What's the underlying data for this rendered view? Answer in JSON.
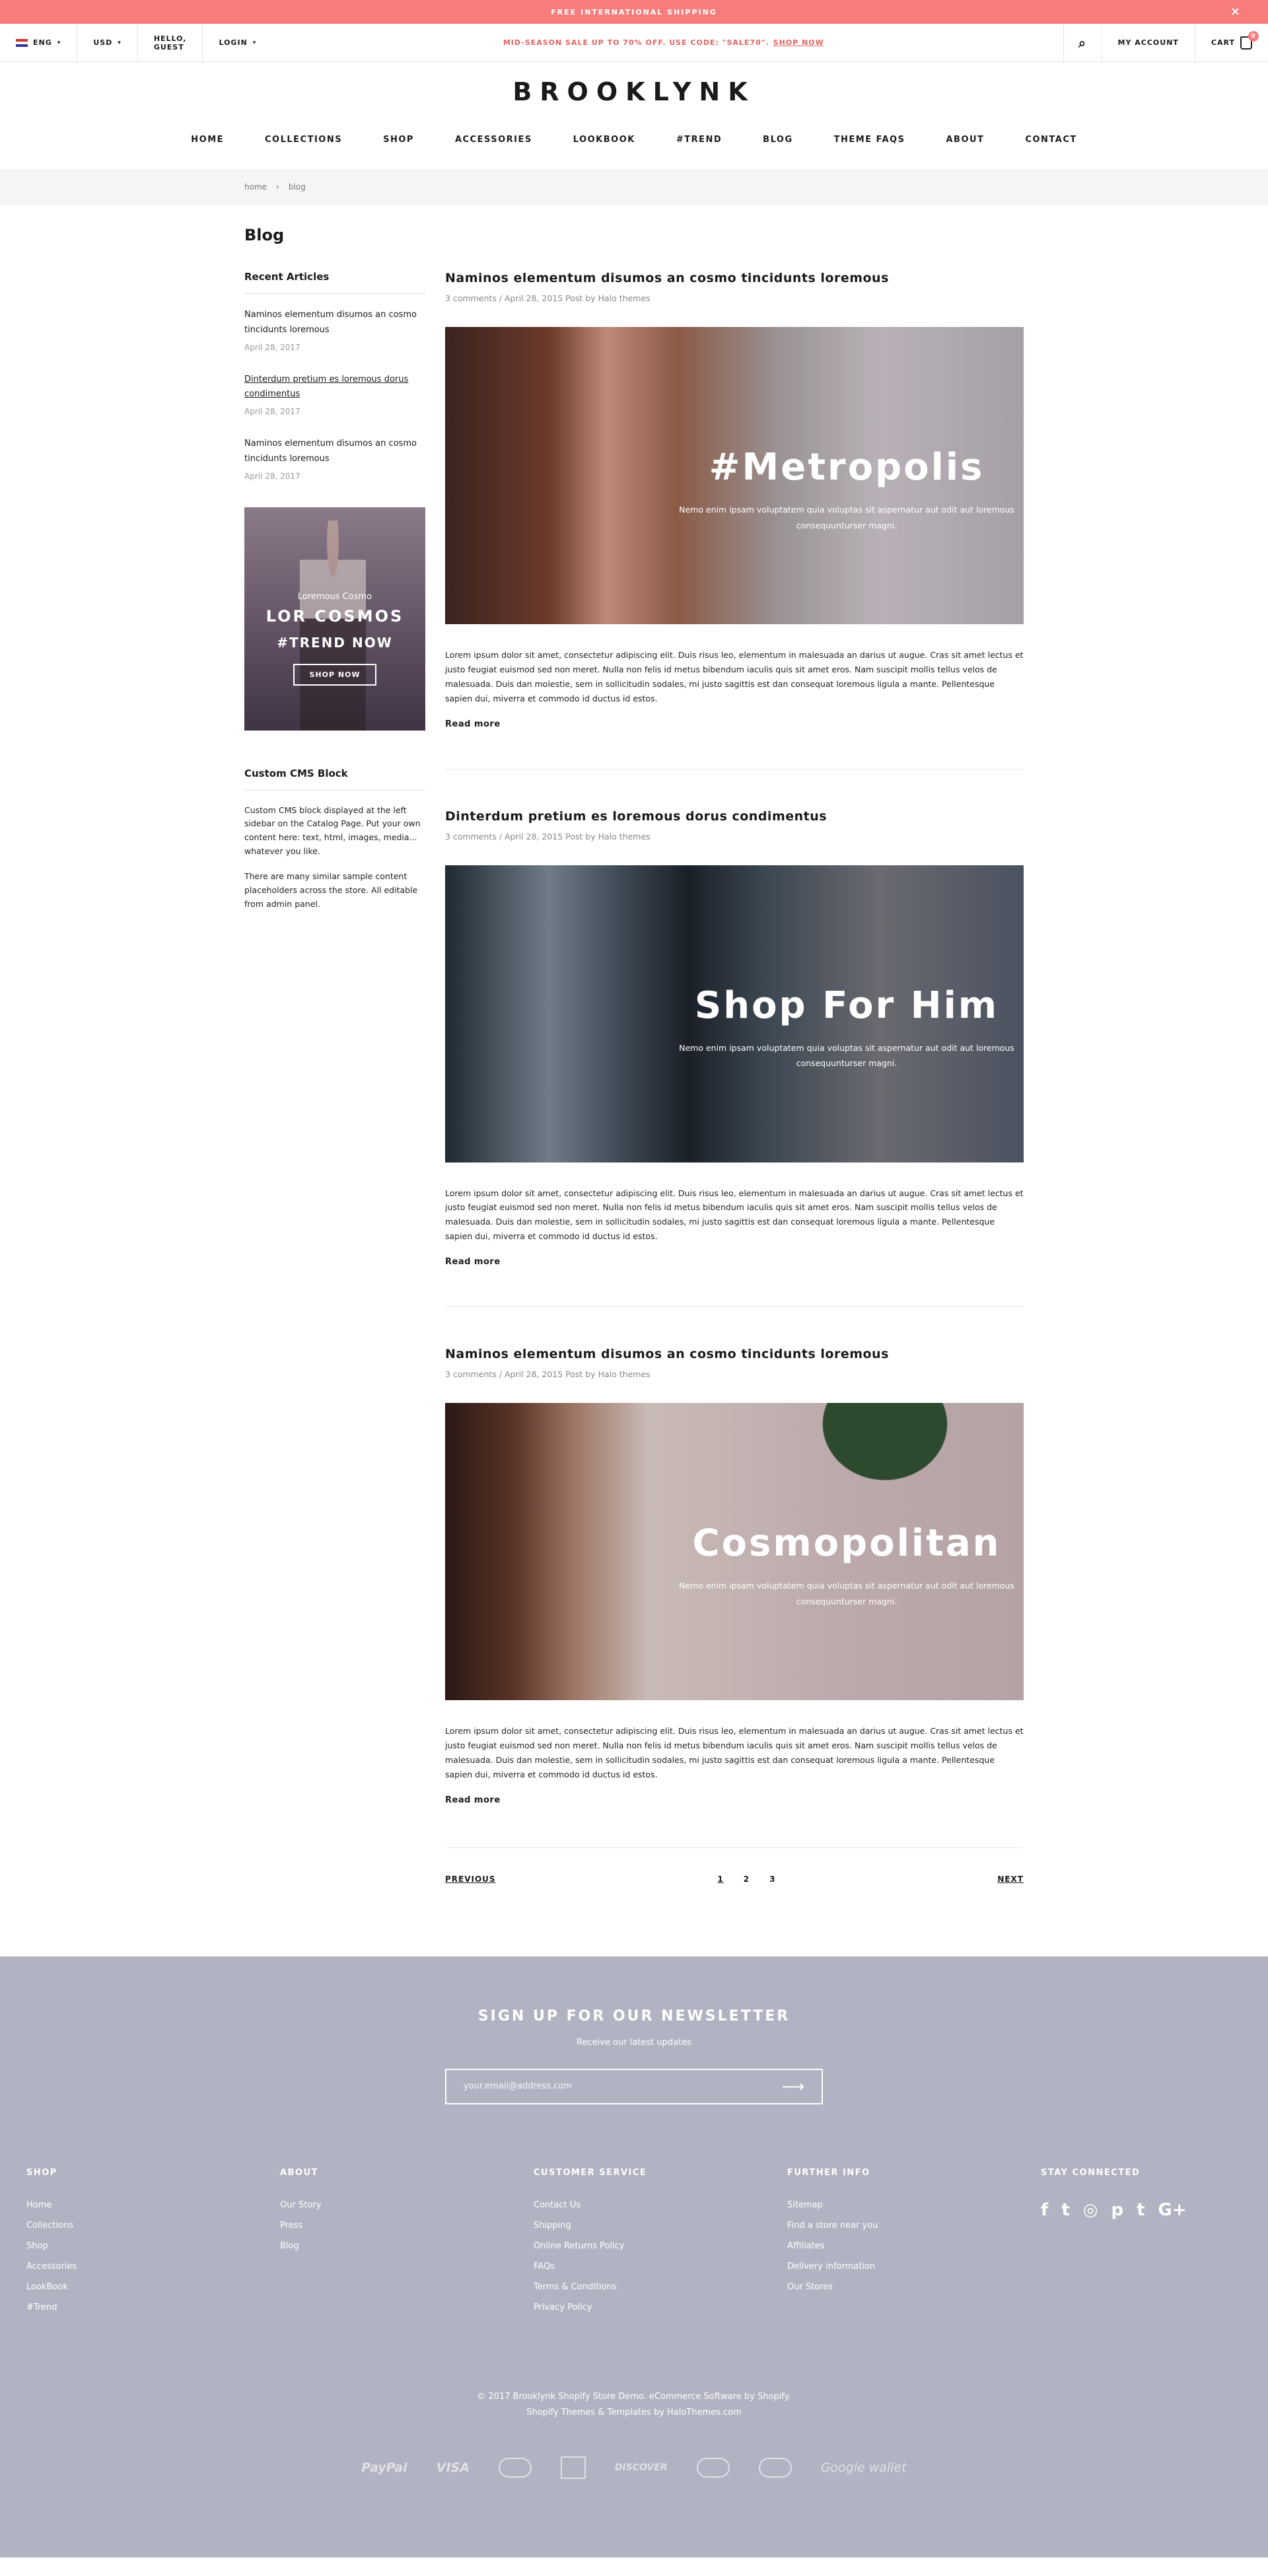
{
  "top_banner": {
    "text": "FREE INTERNATIONAL SHIPPING",
    "close": "×"
  },
  "util": {
    "lang": "ENG",
    "currency": "USD",
    "greeting": "HELLO, GUEST",
    "login": "LOGIN",
    "promo_text": "MID-SEASON SALE UP TO 70% OFF. USE CODE: \"SALE70\".",
    "promo_link": "SHOP NOW",
    "search_icon": "⌕",
    "account": "MY ACCOUNT",
    "cart": "CART",
    "cart_count": "0"
  },
  "logo": "BROOKLYNK",
  "nav": [
    "HOME",
    "COLLECTIONS",
    "SHOP",
    "ACCESSORIES",
    "LOOKBOOK",
    "#TREND",
    "BLOG",
    "THEME FAQS",
    "ABOUT",
    "CONTACT"
  ],
  "breadcrumb": {
    "home": "home",
    "sep": "›",
    "current": "blog"
  },
  "page_title": "Blog",
  "sidebar": {
    "recent_heading": "Recent Articles",
    "recent": [
      {
        "title": "Naminos elementum disumos an cosmo tincidunts loremous",
        "date": "April 28, 2017"
      },
      {
        "title": "Dinterdum pretium es loremous dorus condimentus",
        "date": "April 28, 2017"
      },
      {
        "title": "Naminos elementum disumos an cosmo tincidunts loremous",
        "date": "April 28, 2017"
      }
    ],
    "promo": {
      "small": "Loremous Cosmo",
      "big": "LOR COSMOS",
      "trend": "#TREND NOW",
      "button": "SHOP NOW"
    },
    "cms_heading": "Custom CMS Block",
    "cms_p1": "Custom CMS block displayed at the left sidebar on the Catalog Page. Put your own content here: text, html, images, media... whatever you like.",
    "cms_p2": "There are many similar sample content placeholders across the store. All editable from admin panel."
  },
  "posts": [
    {
      "title": "Naminos elementum disumos an cosmo tincidunts loremous",
      "meta": "3 comments / April 28, 2015 Post by Halo themes",
      "overlay_title": "#Metropolis",
      "overlay_sub": "Nemo enim ipsam voluptatem quia voluptas sit aspernatur aut odit aut loremous consequunturser magni.",
      "excerpt": "Lorem ipsum dolor sit amet, consectetur adipiscing elit. Duis risus leo, elementum in malesuada an darius ut augue. Cras sit amet lectus et justo feugiat euismod sed non meret. Nulla non felis id metus bibendum iaculis quis sit amet eros. Nam suscipit mollis tellus velos de malesuada. Duis dan molestie, sem in sollicitudin sodales, mi justo sagittis est dan consequat loremous ligula a mante. Pellentesque sapien dui, miverra et commodo id ductus id estos.",
      "read_more": "Read more"
    },
    {
      "title": "Dinterdum pretium es loremous dorus condimentus",
      "meta": "3 comments / April 28, 2015 Post by Halo themes",
      "overlay_title": "Shop For Him",
      "overlay_sub": "Nemo enim ipsam voluptatem quia voluptas sit aspernatur aut odit aut loremous consequunturser magni.",
      "excerpt": "Lorem ipsum dolor sit amet, consectetur adipiscing elit. Duis risus leo, elementum in malesuada an darius ut augue. Cras sit amet lectus et justo feugiat euismod sed non meret. Nulla non felis id metus bibendum iaculis quis sit amet eros. Nam suscipit mollis tellus velos de malesuada. Duis dan molestie, sem in sollicitudin sodales, mi justo sagittis est dan consequat loremous ligula a mante. Pellentesque sapien dui, miverra et commodo id ductus id estos.",
      "read_more": "Read more"
    },
    {
      "title": "Naminos elementum disumos an cosmo tincidunts loremous",
      "meta": "3 comments / April 28, 2015 Post by Halo themes",
      "overlay_title": "Cosmopolitan",
      "overlay_sub": "Nemo enim ipsam voluptatem quia voluptas sit aspernatur aut odit aut loremous consequunturser magni.",
      "excerpt": "Lorem ipsum dolor sit amet, consectetur adipiscing elit. Duis risus leo, elementum in malesuada an darius ut augue. Cras sit amet lectus et justo feugiat euismod sed non meret. Nulla non felis id metus bibendum iaculis quis sit amet eros. Nam suscipit mollis tellus velos de malesuada. Duis dan molestie, sem in sollicitudin sodales, mi justo sagittis est dan consequat loremous ligula a mante. Pellentesque sapien dui, miverra et commodo id ductus id estos.",
      "read_more": "Read more"
    }
  ],
  "pagination": {
    "prev": "PREVIOUS",
    "pages": [
      "1",
      "2",
      "3"
    ],
    "next": "NEXT"
  },
  "footer": {
    "news_title": "SIGN UP FOR OUR NEWSLETTER",
    "news_sub": "Receive our latest updates",
    "news_placeholder": "your.email@address.com",
    "news_arrow": "⟶",
    "cols": [
      {
        "heading": "SHOP",
        "links": [
          "Home",
          "Collections",
          "Shop",
          "Accessories",
          "LookBook",
          "#Trend"
        ]
      },
      {
        "heading": "ABOUT",
        "links": [
          "Our Story",
          "Press",
          "Blog"
        ]
      },
      {
        "heading": "CUSTOMER SERVICE",
        "links": [
          "Contact Us",
          "Shipping",
          "Online Returns Policy",
          "FAQs",
          "Terms & Conditions",
          "Privacy Policy"
        ]
      },
      {
        "heading": "FURTHER INFO",
        "links": [
          "Sitemap",
          "Find a store near you",
          "Affiliates",
          "Delivery information",
          "Our Stores"
        ]
      }
    ],
    "stay_heading": "STAY CONNECTED",
    "social": [
      "f",
      "t",
      "◎",
      "p",
      "t",
      "G+"
    ],
    "copyright_1": "© 2017 Brooklynk Shopify Store Demo. eCommerce Software by Shopify.",
    "copyright_2": "Shopify Themes & Templates by HaloThemes.com",
    "payments": [
      "PayPal",
      "VISA",
      "DISCOVER",
      "Google wallet"
    ]
  }
}
